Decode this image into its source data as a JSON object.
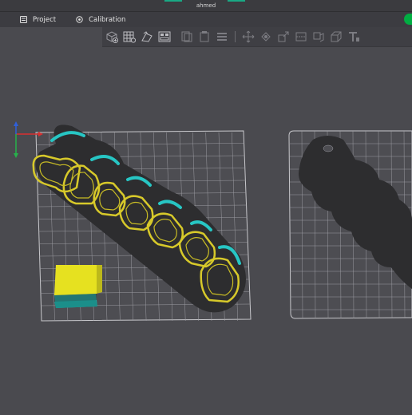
{
  "window": {
    "title": "ahmed"
  },
  "menu": {
    "project_label": "Project",
    "calibration_label": "Calibration"
  },
  "toolbar": {
    "icons": [
      "add-cube-icon",
      "grid-arrange-icon",
      "auto-orient-icon",
      "plate-layout-icon",
      "copy-icon",
      "paste-icon",
      "layers-icon",
      "move-icon",
      "rotate-icon",
      "scale-icon",
      "cut-icon",
      "support-icon",
      "seam-icon",
      "text-icon"
    ]
  },
  "scene": {
    "plate_1_model": "keychain with raised lettering",
    "plate_2_model": "keychain shadow preview"
  },
  "colors": {
    "background": "#4a4a4f",
    "accent": "#00ae42",
    "text_outline": "#d7c92a",
    "text_shadow": "#27c6c4",
    "keychain_body": "#2d2d2f",
    "cube_top": "#e6e120",
    "cube_bottom": "#1ea9a3"
  }
}
